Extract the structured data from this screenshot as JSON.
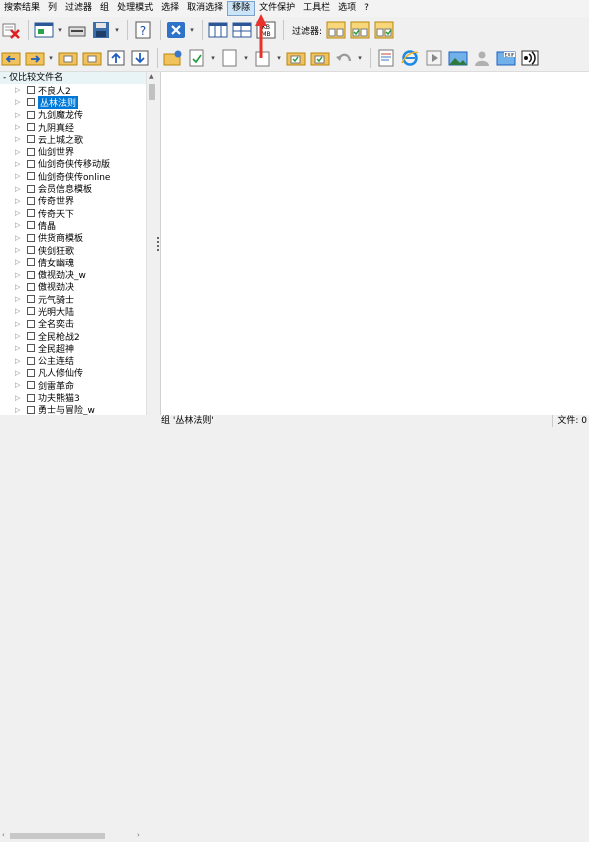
{
  "menu": {
    "items": [
      "搜索结果",
      "列",
      "过滤器",
      "组",
      "处理模式",
      "选择",
      "取消选择",
      "移除",
      "文件保护",
      "工具栏",
      "选项",
      "?"
    ],
    "active_index": 7
  },
  "toolbar": {
    "filter_label": "过滤器:"
  },
  "left_panel": {
    "header": "- 仅比较文件名",
    "tree": [
      {
        "label": "不良人2"
      },
      {
        "label": "丛林法则",
        "selected": true
      },
      {
        "label": "九剑魔龙传"
      },
      {
        "label": "九阴真经"
      },
      {
        "label": "云上城之歌"
      },
      {
        "label": "仙剑世界"
      },
      {
        "label": "仙剑奇侠传移动版"
      },
      {
        "label": "仙剑奇侠传online"
      },
      {
        "label": "会员信息模板"
      },
      {
        "label": "传奇世界"
      },
      {
        "label": "传奇天下"
      },
      {
        "label": "倩晶"
      },
      {
        "label": "供货商模板"
      },
      {
        "label": "侠剑狂歌"
      },
      {
        "label": "倩女幽魂"
      },
      {
        "label": "傲视劲决_w"
      },
      {
        "label": "傲视劲决"
      },
      {
        "label": "元气骑士"
      },
      {
        "label": "光明大陆"
      },
      {
        "label": "全名奕击"
      },
      {
        "label": "全民枪战2"
      },
      {
        "label": "全民超神"
      },
      {
        "label": "公主连结"
      },
      {
        "label": "凡人修仙传"
      },
      {
        "label": "剑雷革命"
      },
      {
        "label": "功夫熊猫3"
      },
      {
        "label": "勇士与冒险_w"
      }
    ]
  },
  "status": {
    "group": "组 '丛林法则'",
    "files": "文件: 0"
  },
  "colors": {
    "selection": "#0078d7",
    "active_menu_bg": "#cce4f7",
    "annotation_arrow": "#e8322c"
  }
}
